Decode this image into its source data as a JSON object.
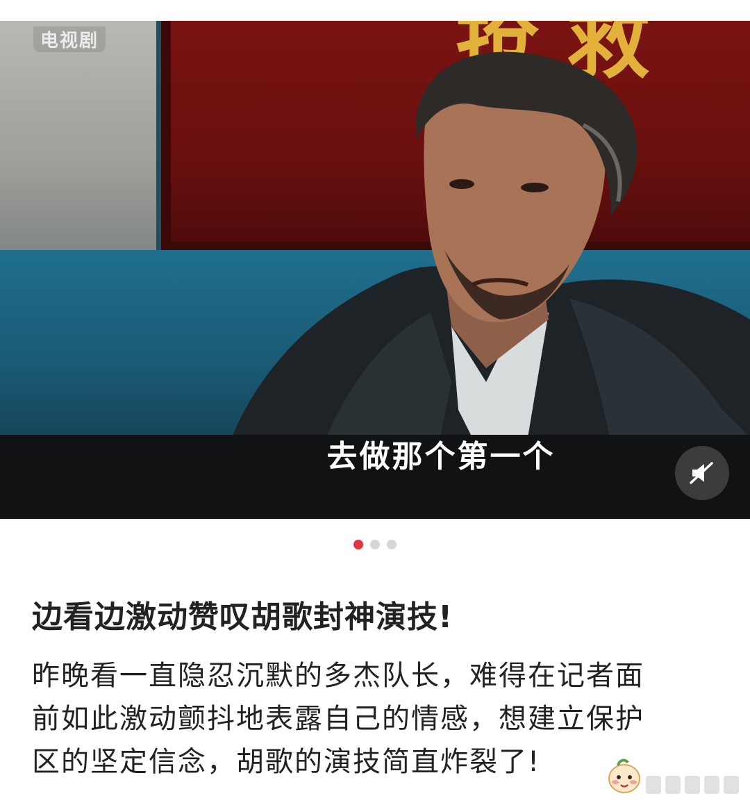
{
  "video": {
    "corner_label": "电视剧",
    "banner_text": "抢救机",
    "subtitle": "去做那个第一个"
  },
  "carousel": {
    "count": 3,
    "active_index": 0
  },
  "post": {
    "title": "边看边激动赞叹胡歌封神演技!",
    "body_lines": [
      "昨晚看一直隐忍沉默的多杰队长，难得在记者面",
      "前如此激动颤抖地表露自己的情感，想建立保护",
      "区的坚定信念，胡歌的演技简直炸裂了!"
    ]
  },
  "icons": {
    "mute": "speaker-muted-icon",
    "emoji": "blush-emoji-icon"
  },
  "colors": {
    "active_dot": "#e2363f",
    "inactive_dot": "#d7d7d7",
    "banner_red": "#7a1412",
    "banner_text_gold": "#e2b13a"
  }
}
